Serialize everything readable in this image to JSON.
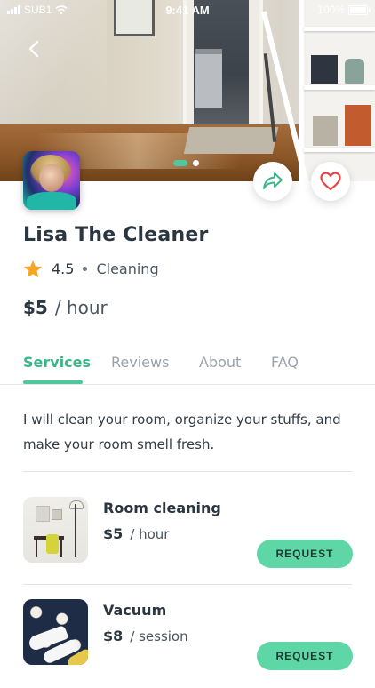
{
  "status_bar": {
    "carrier": "SUB1",
    "time": "9:41 AM",
    "battery": "100%",
    "battery_level": 1.0
  },
  "hero": {
    "back_icon": "chevron-left-icon",
    "carousel": {
      "total": 2,
      "active_index": 0
    }
  },
  "actions": {
    "share_icon": "share-icon",
    "favorite_icon": "heart-icon"
  },
  "profile": {
    "name": "Lisa The Cleaner",
    "rating": "4.5",
    "category": "Cleaning",
    "price": "$5",
    "price_unit": "/ hour"
  },
  "tabs": [
    {
      "label": "Services",
      "active": true
    },
    {
      "label": "Reviews",
      "active": false
    },
    {
      "label": "About",
      "active": false
    },
    {
      "label": "FAQ",
      "active": false
    }
  ],
  "description": "I will clean your room, organize your stuffs, and make your room smell fresh.",
  "services": [
    {
      "title": "Room cleaning",
      "price": "$5",
      "unit": "/ hour",
      "button": "REQUEST"
    },
    {
      "title": "Vacuum",
      "price": "$8",
      "unit": "/ session",
      "button": "REQUEST"
    }
  ],
  "colors": {
    "accent": "#4fc89c",
    "accent_text": "#3ab789",
    "button_bg": "#5fd6a5",
    "star": "#f6a623",
    "heart": "#e64545",
    "text_dark": "#2b3640",
    "text_muted": "#9aa3ab"
  }
}
